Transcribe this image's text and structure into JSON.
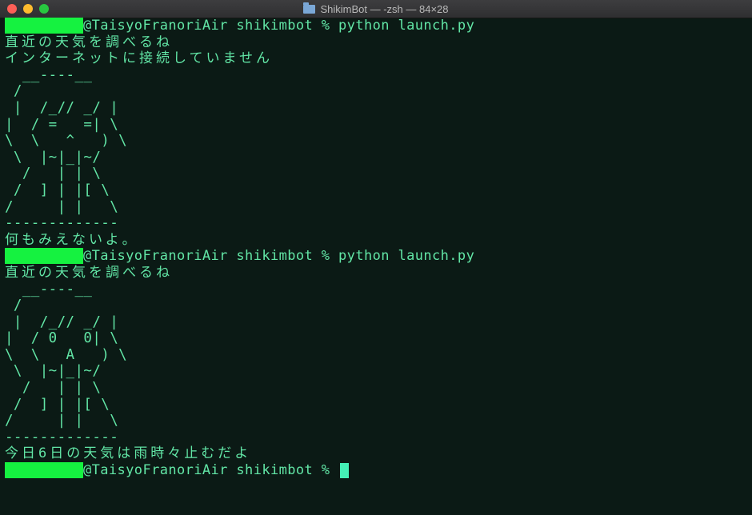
{
  "window": {
    "title": "ShikimBot — -zsh — 84×28"
  },
  "session1": {
    "prompt_host": "@TaisyoFranoriAir shikimbot % ",
    "command": "python launch.py",
    "weather_msg": "直近の天気を調べるね",
    "error_msg": "インターネットに接続していません",
    "art": [
      "  __----__",
      " /",
      " |  /_// _/ |",
      "|  / =   =| \\",
      "\\  \\   ^   ) \\",
      " \\  |~|_|~/",
      "  /   | | \\",
      " /  ] | |[ \\",
      "/     | |   \\",
      "-------------"
    ],
    "result_msg": "何もみえないよ。"
  },
  "session2": {
    "prompt_host": "@TaisyoFranoriAir shikimbot % ",
    "command": "python launch.py",
    "weather_msg": "直近の天気を調べるね",
    "art": [
      "  __----__",
      " /",
      " |  /_// _/ |",
      "|  / 0   0| \\",
      "\\  \\   A   ) \\",
      " \\  |~|_|~/",
      "  /   | | \\",
      " /  ] | |[ \\",
      "/     | |   \\",
      "-------------"
    ],
    "result_msg": "今日6日の天気は雨時々止むだよ"
  },
  "final_prompt": {
    "prompt_host": "@TaisyoFranoriAir shikimbot % "
  },
  "colors": {
    "background": "#0b1a15",
    "text": "#62e6a6",
    "redaction": "#15f240",
    "cursor": "#45f0b6"
  }
}
